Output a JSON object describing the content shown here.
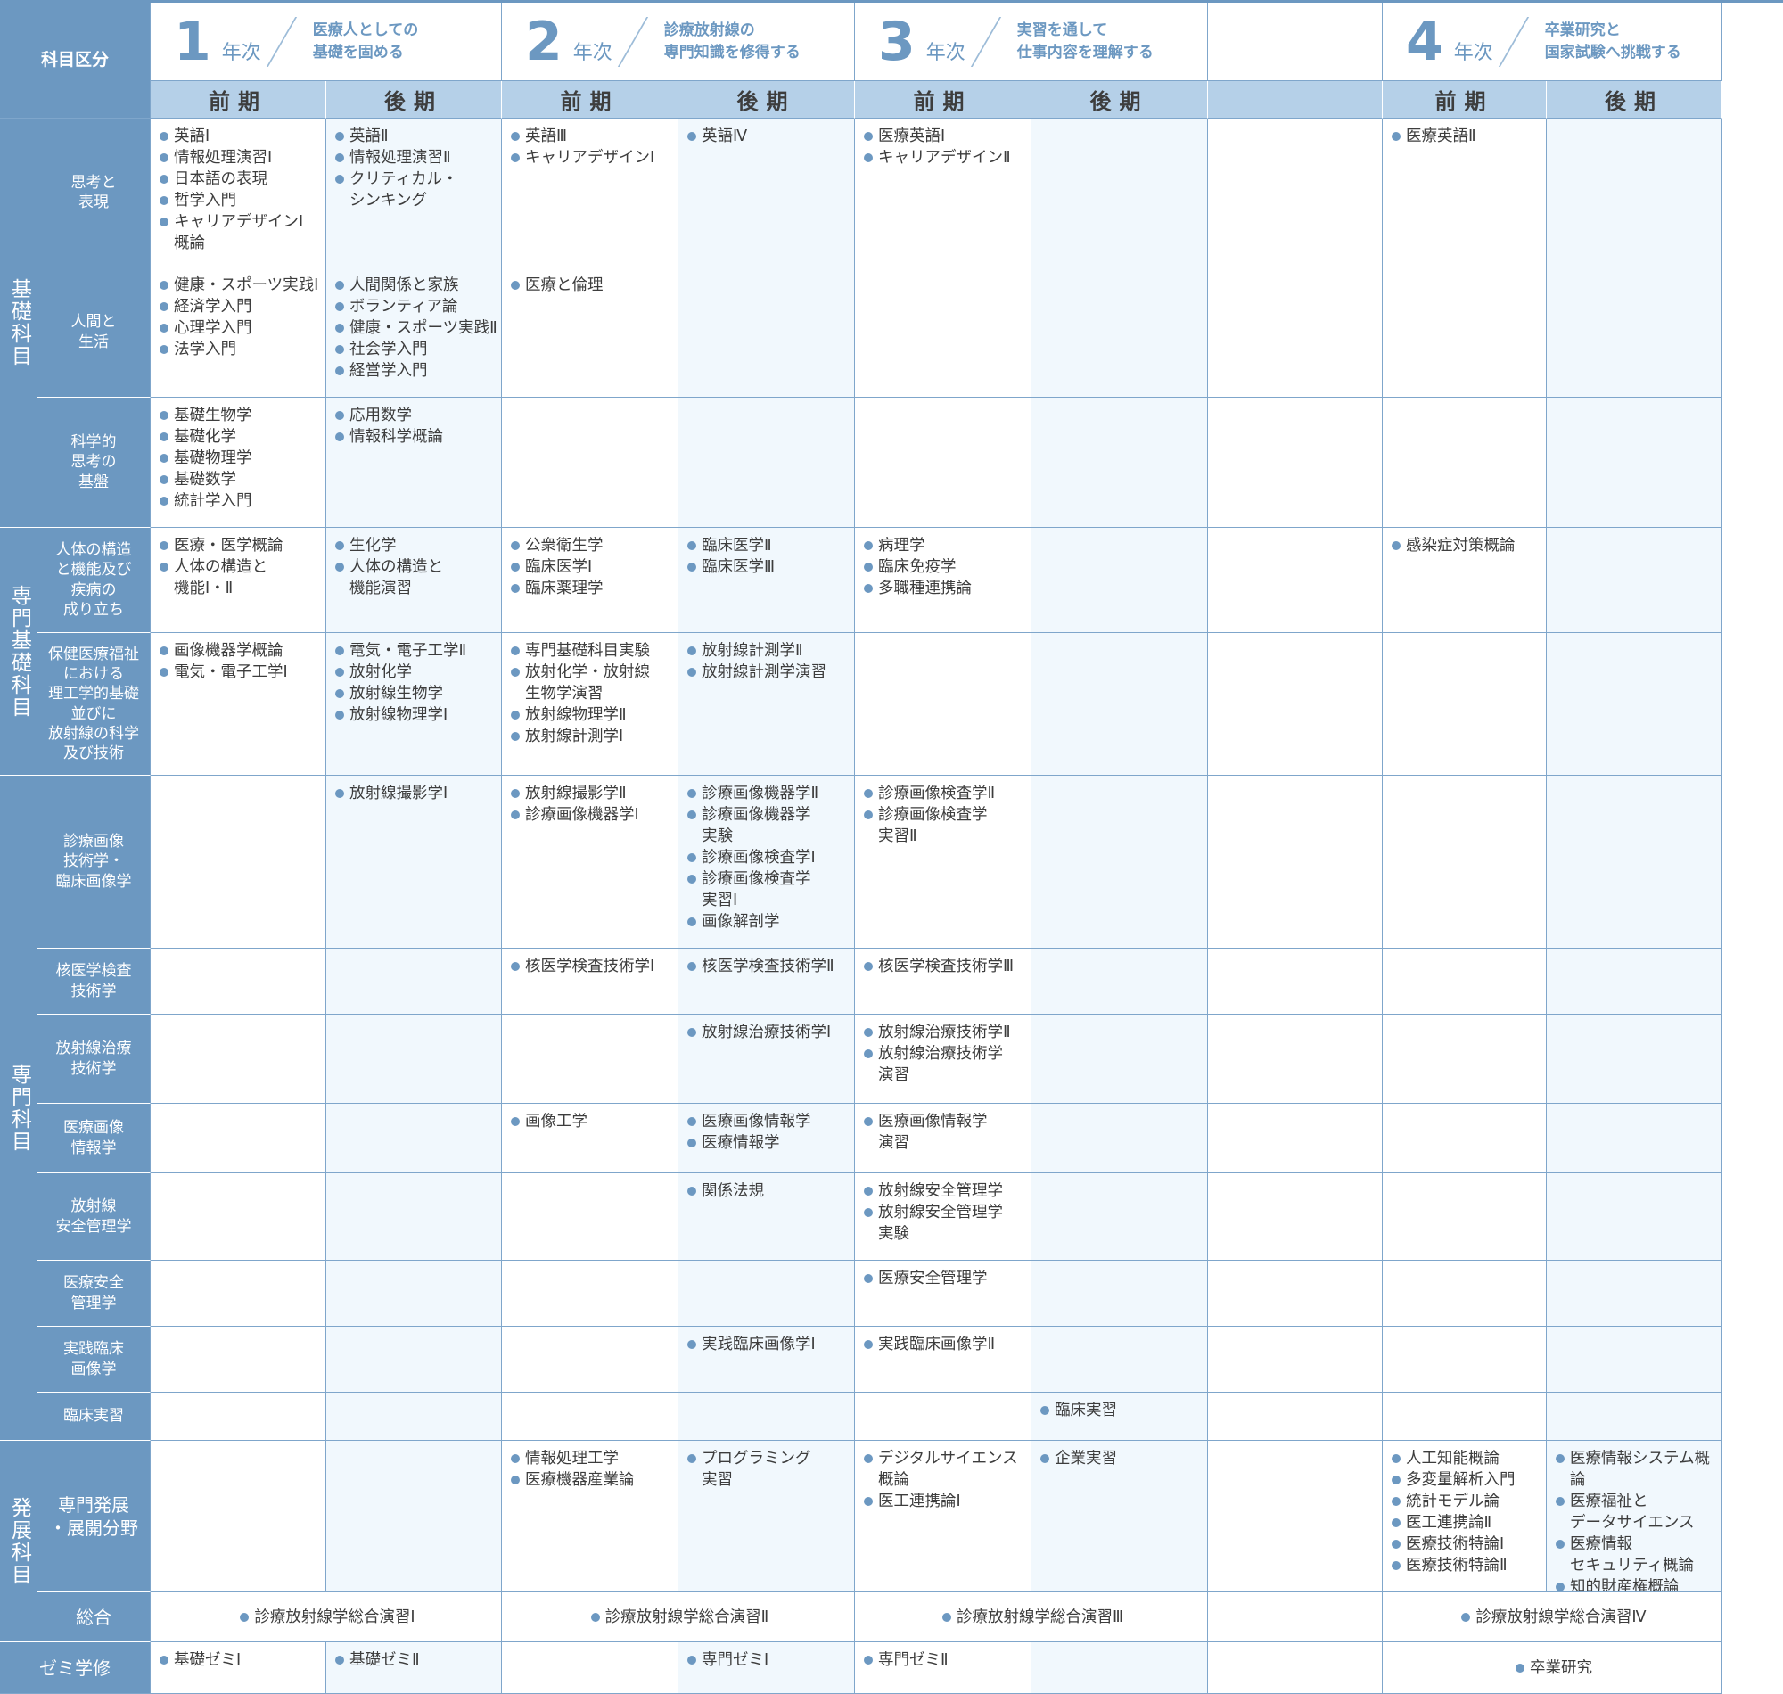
{
  "header": {
    "corner": "科目区分",
    "years": [
      {
        "num": "1",
        "label": "年次",
        "desc": "医療人としての\n基礎を固める"
      },
      {
        "num": "2",
        "label": "年次",
        "desc": "診療放射線の\n専門知識を修得する"
      },
      {
        "num": "3",
        "label": "年次",
        "desc": "実習を通して\n仕事内容を理解する"
      },
      {
        "num": "4",
        "label": "年次",
        "desc": "卒業研究と\n国家試験へ挑戦する"
      }
    ],
    "terms": [
      "前期",
      "後期",
      "前期",
      "後期",
      "前期",
      "後期",
      "前期",
      "後期"
    ]
  },
  "categories": [
    "基礎科目",
    "専門基礎科目",
    "専門科目",
    "発展科目"
  ],
  "subcategories": [
    "思考と\n表現",
    "人間と\n生活",
    "科学的\n思考の\n基盤",
    "人体の構造\nと機能及び\n疾病の\n成り立ち",
    "保健医療福祉\nにおける\n理工学的基礎\n並びに\n放射線の科学\n及び技術",
    "診療画像\n技術学・\n臨床画像学",
    "核医学検査\n技術学",
    "放射線治療\n技術学",
    "医療画像\n情報学",
    "放射線\n安全管理学",
    "医療安全\n管理学",
    "実践臨床\n画像学",
    "臨床実習",
    "専門発展\n・展開分野",
    "総合",
    "ゼミ学修"
  ],
  "rows": [
    [
      [
        "英語Ⅰ",
        "情報処理演習Ⅰ",
        "日本語の表現",
        "哲学入門",
        "キャリアデザインⅠ\n概論"
      ],
      [
        "英語Ⅱ",
        "情報処理演習Ⅱ",
        "クリティカル・\nシンキング"
      ],
      [
        "英語Ⅲ",
        "キャリアデザインⅠ"
      ],
      [
        "英語Ⅳ"
      ],
      [
        "医療英語Ⅰ",
        "キャリアデザインⅡ"
      ],
      [],
      [
        "医療英語Ⅱ"
      ],
      []
    ],
    [
      [
        "健康・スポーツ実践Ⅰ",
        "経済学入門",
        "心理学入門",
        "法学入門"
      ],
      [
        "人間関係と家族",
        "ボランティア論",
        "健康・スポーツ実践Ⅱ",
        "社会学入門",
        "経営学入門"
      ],
      [
        "医療と倫理"
      ],
      [],
      [],
      [],
      [],
      []
    ],
    [
      [
        "基礎生物学",
        "基礎化学",
        "基礎物理学",
        "基礎数学",
        "統計学入門"
      ],
      [
        "応用数学",
        "情報科学概論"
      ],
      [],
      [],
      [],
      [],
      [],
      []
    ],
    [
      [
        "医療・医学概論",
        "人体の構造と\n機能Ⅰ・Ⅱ"
      ],
      [
        "生化学",
        "人体の構造と\n機能演習"
      ],
      [
        "公衆衛生学",
        "臨床医学Ⅰ",
        "臨床薬理学"
      ],
      [
        "臨床医学Ⅱ",
        "臨床医学Ⅲ"
      ],
      [
        "病理学",
        "臨床免疫学",
        "多職種連携論"
      ],
      [],
      [
        "感染症対策概論"
      ],
      []
    ],
    [
      [
        "画像機器学概論",
        "電気・電子工学Ⅰ"
      ],
      [
        "電気・電子工学Ⅱ",
        "放射化学",
        "放射線生物学",
        "放射線物理学Ⅰ"
      ],
      [
        "専門基礎科目実験",
        "放射化学・放射線\n生物学演習",
        "放射線物理学Ⅱ",
        "放射線計測学Ⅰ"
      ],
      [
        "放射線計測学Ⅱ",
        "放射線計測学演習"
      ],
      [],
      [],
      [],
      []
    ],
    [
      [],
      [
        "放射線撮影学Ⅰ"
      ],
      [
        "放射線撮影学Ⅱ",
        "診療画像機器学Ⅰ"
      ],
      [
        "診療画像機器学Ⅱ",
        "診療画像機器学\n実験",
        "診療画像検査学Ⅰ",
        "診療画像検査学\n実習Ⅰ",
        "画像解剖学"
      ],
      [
        "診療画像検査学Ⅱ",
        "診療画像検査学\n実習Ⅱ"
      ],
      [],
      [],
      []
    ],
    [
      [],
      [],
      [
        "核医学検査技術学Ⅰ"
      ],
      [
        "核医学検査技術学Ⅱ"
      ],
      [
        "核医学検査技術学Ⅲ"
      ],
      [],
      [],
      []
    ],
    [
      [],
      [],
      [],
      [
        "放射線治療技術学Ⅰ"
      ],
      [
        "放射線治療技術学Ⅱ",
        "放射線治療技術学\n演習"
      ],
      [],
      [],
      []
    ],
    [
      [],
      [],
      [
        "画像工学"
      ],
      [
        "医療画像情報学",
        "医療情報学"
      ],
      [
        "医療画像情報学\n演習"
      ],
      [],
      [],
      []
    ],
    [
      [],
      [],
      [],
      [
        "関係法規"
      ],
      [
        "放射線安全管理学",
        "放射線安全管理学\n実験"
      ],
      [],
      [],
      []
    ],
    [
      [],
      [],
      [],
      [],
      [
        "医療安全管理学"
      ],
      [],
      [],
      []
    ],
    [
      [],
      [],
      [],
      [
        "実践臨床画像学Ⅰ"
      ],
      [
        "実践臨床画像学Ⅱ"
      ],
      [],
      [],
      []
    ],
    [
      [],
      [],
      [],
      [],
      [],
      [
        "臨床実習"
      ],
      [],
      []
    ],
    [
      [],
      [],
      [
        "情報処理工学",
        "医療機器産業論"
      ],
      [
        "プログラミング\n実習"
      ],
      [
        "デジタルサイエンス\n概論",
        "医工連携論Ⅰ"
      ],
      [
        "企業実習"
      ],
      [
        "人工知能概論",
        "多変量解析入門",
        "統計モデル論",
        "医工連携論Ⅱ",
        "医療技術特論Ⅰ",
        "医療技術特論Ⅱ"
      ],
      [
        "医療情報システム概論",
        "医療福祉と\nデータサイエンス",
        "医療情報\nセキュリティ概論",
        "知的財産権概論"
      ]
    ]
  ],
  "sogo": [
    "診療放射線学総合演習Ⅰ",
    "診療放射線学総合演習Ⅱ",
    "診療放射線学総合演習Ⅲ",
    "診療放射線学総合演習Ⅳ"
  ],
  "zemi": [
    "基礎ゼミⅠ",
    "基礎ゼミⅡ",
    "専門ゼミⅠ",
    "専門ゼミⅡ",
    "卒業研究"
  ]
}
